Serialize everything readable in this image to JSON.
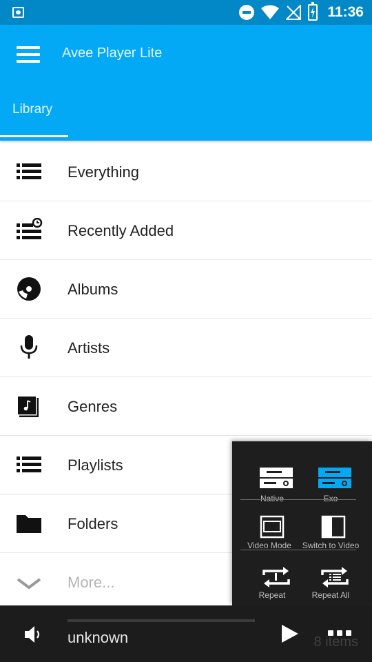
{
  "status_bar": {
    "time": "11:36"
  },
  "app_bar": {
    "title": "Avee Player Lite"
  },
  "tabs": [
    {
      "label": "Library"
    }
  ],
  "library": {
    "items": [
      {
        "label": "Everything",
        "icon": "list-icon"
      },
      {
        "label": "Recently Added",
        "icon": "recently-added-icon"
      },
      {
        "label": "Albums",
        "icon": "album-disc-icon"
      },
      {
        "label": "Artists",
        "icon": "microphone-icon"
      },
      {
        "label": "Genres",
        "icon": "music-note-icon"
      },
      {
        "label": "Playlists",
        "icon": "playlist-icon"
      },
      {
        "label": "Folders",
        "icon": "folder-icon"
      },
      {
        "label": "More...",
        "icon": "chevron-down-icon"
      }
    ]
  },
  "popup": {
    "native_label": "Native",
    "exo_label": "Exo",
    "video_mode_label": "Video Mode",
    "switch_to_video_label": "Switch to Video",
    "repeat_label": "Repeat",
    "repeat_all_label": "Repeat All",
    "accent": "#03a9f4"
  },
  "player": {
    "track_title": "unknown",
    "items_count": "8 items",
    "progress": 0
  },
  "colors": {
    "primary": "#03a9f4",
    "status_bar": "#0288c7",
    "dark": "#1c1c1c"
  }
}
